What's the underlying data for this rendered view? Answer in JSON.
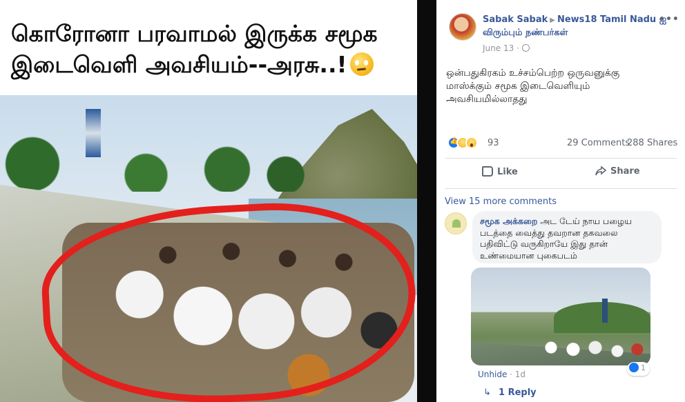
{
  "meme": {
    "caption_line1": "கொரோனா பரவாமல் இருக்க சமூக",
    "caption_line2": "இடைவெளி அவசியம்--அரசு..!",
    "emoji": "face-with-rolling-eyes-icon"
  },
  "post": {
    "author": "Sabak Sabak",
    "separator_icon": "right-triangle-icon",
    "group": "News18 Tamil Nadu ஐ",
    "group_line2": "விரும்பும் நண்பர்கள்",
    "more_label": "•••",
    "date": "June 13 ·",
    "text": "ஒன்பதுகிரகம் உச்சம்பெற்ற ஒருவனுக்கு\nமாஸ்க்கும் சமூக இடைவெளியும்\nஅவசியமில்லாதது",
    "reaction_count": "93",
    "comments_count": "29 Comments",
    "shares_count": "288 Shares"
  },
  "actions": {
    "like_label": "Like",
    "share_label": "Share"
  },
  "comments": {
    "view_more": "View 15 more comments",
    "items": [
      {
        "author": "சமூக அக்கறை",
        "text": "அட டேய் நாய பழைய படத்தை வைத்து தவறான தகவலை பதிவிட்டு வருகிறாயே இது தான் உண்மையான புகைபடம்",
        "unhide_label": "Unhide",
        "time": "1d",
        "reaction_count": "1",
        "reply_label": "1 Reply"
      }
    ]
  },
  "colors": {
    "link": "#385898",
    "secondary_text": "#606770",
    "meme_ring": "#e3201c"
  }
}
